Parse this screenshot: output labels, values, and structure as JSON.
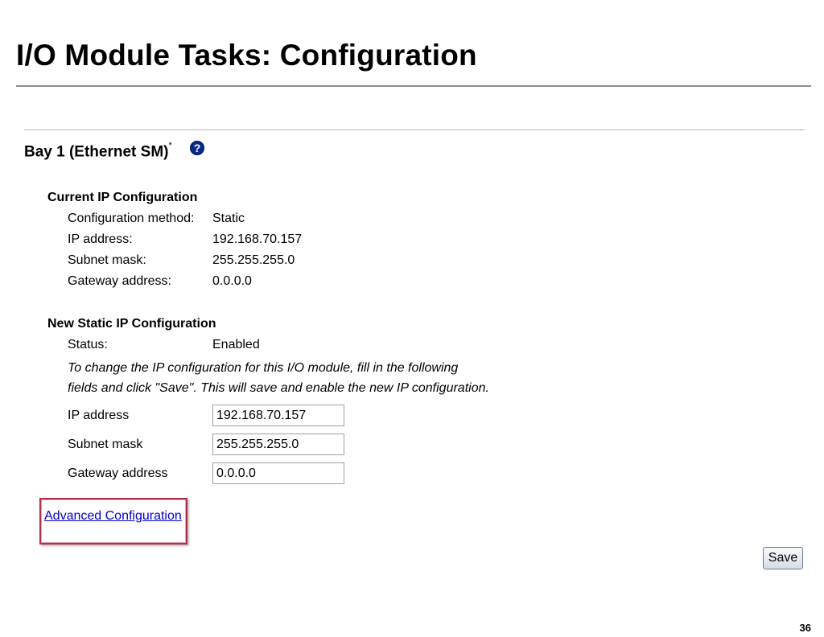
{
  "slide": {
    "title": "I/O Module Tasks: Configuration",
    "page_number": "36"
  },
  "bay": {
    "heading": "Bay 1 (Ethernet SM)",
    "footnote_mark": "*",
    "help_icon": "help-icon",
    "help_glyph": "?"
  },
  "current": {
    "heading": "Current IP Configuration",
    "rows": [
      {
        "label": "Configuration method:",
        "value": "Static"
      },
      {
        "label": "IP address:",
        "value": "192.168.70.157"
      },
      {
        "label": "Subnet mask:",
        "value": "255.255.255.0"
      },
      {
        "label": "Gateway address:",
        "value": "0.0.0.0"
      }
    ]
  },
  "new_config": {
    "heading": "New Static IP Configuration",
    "status_label": "Status:",
    "status_value": "Enabled",
    "note_line1": "To change the IP configuration for this I/O module, fill in the following",
    "note_line2": "fields and click \"Save\". This will save and enable the new IP configuration.",
    "fields": [
      {
        "label": "IP address",
        "value": "192.168.70.157"
      },
      {
        "label": "Subnet mask",
        "value": "255.255.255.0"
      },
      {
        "label": "Gateway address",
        "value": "0.0.0.0"
      }
    ]
  },
  "advanced_link": "Advanced Configuration",
  "save_label": "Save",
  "colors": {
    "link": "#0000cc",
    "highlight_border": "#b0304a",
    "help_icon": "#0a2a8a"
  }
}
